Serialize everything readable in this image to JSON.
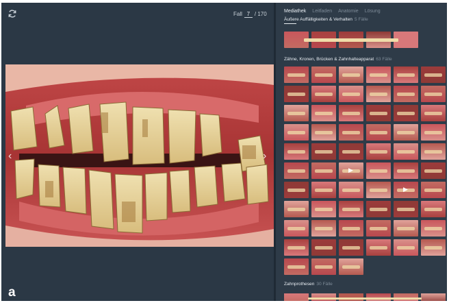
{
  "viewer": {
    "case_prefix": "Fall",
    "case_current": "7",
    "case_total": "/ 170",
    "figure_label": "a",
    "prev_arrow": "‹",
    "next_arrow": "›"
  },
  "sidebar": {
    "tabs": [
      {
        "label": "Mediathek",
        "active": true
      },
      {
        "label": "Leitfaden",
        "active": false
      },
      {
        "label": "Anatomie",
        "active": false
      },
      {
        "label": "Lösung",
        "active": false
      }
    ],
    "sections": [
      {
        "title": "Äußere Auffälligkeiten & Verhalten",
        "count": "5 Fälle",
        "thumb_count": 5
      },
      {
        "title": "Zähne, Kronen, Brücken & Zahnhalteapparat",
        "count": "63 Fälle",
        "thumb_count": 63,
        "video_thumb_indices": [
          32,
          40
        ]
      },
      {
        "title": "Zahnprothesen",
        "count": "30 Fälle",
        "thumb_count": 6
      }
    ]
  },
  "colors": {
    "panel_bg": "#2b3845",
    "sidebar_bg": "#2e3b48",
    "active_text": "#e8edf2",
    "muted_text": "#7e8b98",
    "gum_red": "#b83d3d",
    "tooth_yellow": "#e0c98f"
  },
  "icons": {
    "refresh": "refresh-icon",
    "play": "play-icon"
  }
}
